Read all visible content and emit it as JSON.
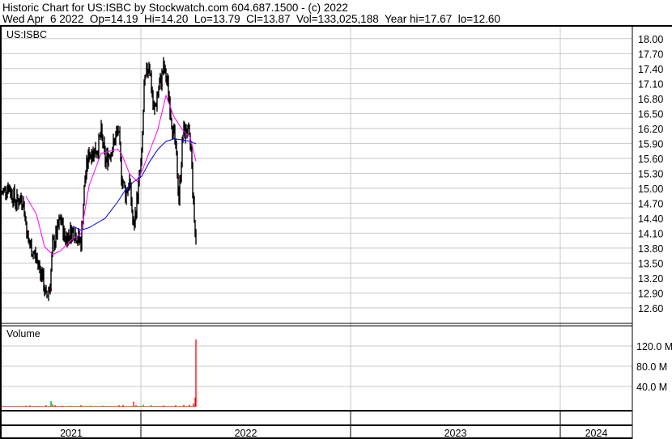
{
  "header": {
    "title": "Historic Chart for US:ISBC by Stockwatch.com 604.687.1500 - (c) 2022",
    "quote": "Wed Apr  6 2022  Op=14.19  Hi=14.20  Lo=13.79  Cl=13.87  Vol=133,025,188  Year hi=17.67  lo=12.60"
  },
  "chart_data": {
    "type": "line",
    "symbol": "US:ISBC",
    "x_unit": "trading days from chart start",
    "xlim": [
      0,
      779
    ],
    "year_boundaries": [
      172,
      431,
      690
    ],
    "year_labels": [
      "2021",
      "2022",
      "2023",
      "2024"
    ],
    "price": {
      "ylim": [
        12.29,
        18.24
      ],
      "ticks": [
        "18.00",
        "17.70",
        "17.40",
        "17.10",
        "16.80",
        "16.50",
        "16.20",
        "15.90",
        "15.60",
        "15.30",
        "15.00",
        "14.70",
        "14.40",
        "14.10",
        "13.80",
        "13.50",
        "13.20",
        "12.90",
        "12.60"
      ],
      "close": [
        [
          0,
          14.89
        ],
        [
          8,
          15.05
        ],
        [
          18,
          14.72
        ],
        [
          26,
          14.81
        ],
        [
          33,
          13.91
        ],
        [
          43,
          13.59
        ],
        [
          50,
          13.26
        ],
        [
          55,
          12.78
        ],
        [
          60,
          13.1
        ],
        [
          63,
          13.83
        ],
        [
          68,
          14.08
        ],
        [
          73,
          14.4
        ],
        [
          78,
          13.99
        ],
        [
          88,
          14.16
        ],
        [
          98,
          13.91
        ],
        [
          103,
          15.21
        ],
        [
          108,
          15.7
        ],
        [
          118,
          15.78
        ],
        [
          123,
          16.1
        ],
        [
          128,
          15.54
        ],
        [
          138,
          15.86
        ],
        [
          144,
          16.18
        ],
        [
          148,
          15.29
        ],
        [
          153,
          14.89
        ],
        [
          158,
          15.13
        ],
        [
          163,
          14.16
        ],
        [
          168,
          14.89
        ],
        [
          173,
          15.62
        ],
        [
          176,
          16.99
        ],
        [
          182,
          17.56
        ],
        [
          188,
          16.51
        ],
        [
          194,
          16.99
        ],
        [
          200,
          17.4
        ],
        [
          205,
          17.08
        ],
        [
          210,
          16.35
        ],
        [
          215,
          15.78
        ],
        [
          219,
          14.81
        ],
        [
          224,
          16.1
        ],
        [
          229,
          16.18
        ],
        [
          234,
          15.78
        ],
        [
          237,
          14.64
        ],
        [
          240,
          13.87
        ]
      ],
      "ma_short": [
        [
          30,
          14.84
        ],
        [
          43,
          14.48
        ],
        [
          53,
          13.83
        ],
        [
          63,
          13.67
        ],
        [
          73,
          13.75
        ],
        [
          88,
          13.99
        ],
        [
          98,
          14.08
        ],
        [
          108,
          15.05
        ],
        [
          123,
          15.7
        ],
        [
          143,
          15.78
        ],
        [
          148,
          15.7
        ],
        [
          158,
          15.29
        ],
        [
          168,
          15.13
        ],
        [
          178,
          15.54
        ],
        [
          193,
          16.18
        ],
        [
          203,
          16.86
        ],
        [
          213,
          16.43
        ],
        [
          223,
          16.18
        ],
        [
          233,
          16.02
        ],
        [
          240,
          15.54
        ]
      ],
      "ma_long": [
        [
          88,
          14.24
        ],
        [
          98,
          14.16
        ],
        [
          108,
          14.21
        ],
        [
          128,
          14.4
        ],
        [
          143,
          14.72
        ],
        [
          153,
          14.97
        ],
        [
          163,
          15.13
        ],
        [
          173,
          15.24
        ],
        [
          183,
          15.54
        ],
        [
          193,
          15.78
        ],
        [
          203,
          15.94
        ],
        [
          213,
          15.99
        ],
        [
          223,
          15.97
        ],
        [
          233,
          15.94
        ],
        [
          240,
          15.89
        ]
      ]
    },
    "volume": {
      "label": "Volume",
      "ylim": [
        0,
        160
      ],
      "unit": "M",
      "ticks": [
        "120.0 M",
        "80.0 M",
        "40.0 M"
      ],
      "tick_values": [
        120,
        80,
        40
      ],
      "baseline_million": 1.2,
      "bars": [
        [
          30,
          2,
          "red"
        ],
        [
          35,
          2.5,
          "red"
        ],
        [
          45,
          1.8,
          "green"
        ],
        [
          55,
          3,
          "red"
        ],
        [
          61,
          11,
          "green"
        ],
        [
          63,
          5,
          "green"
        ],
        [
          66,
          3,
          "red"
        ],
        [
          75,
          2,
          "red"
        ],
        [
          85,
          2,
          "green"
        ],
        [
          98,
          3,
          "red"
        ],
        [
          110,
          2,
          "green"
        ],
        [
          125,
          2.2,
          "green"
        ],
        [
          145,
          3,
          "red"
        ],
        [
          150,
          3.5,
          "red"
        ],
        [
          163,
          10,
          "red"
        ],
        [
          166,
          3,
          "red"
        ],
        [
          175,
          4,
          "green"
        ],
        [
          185,
          3,
          "green"
        ],
        [
          200,
          2.5,
          "red"
        ],
        [
          215,
          3,
          "red"
        ],
        [
          225,
          3.5,
          "red"
        ],
        [
          232,
          4,
          "red"
        ],
        [
          237,
          6,
          "red"
        ],
        [
          239,
          18,
          "red"
        ],
        [
          240,
          133,
          "red"
        ]
      ]
    },
    "colors": {
      "bars": "#000000",
      "close_tick": "#ff0000",
      "ma_short": "#ff00ff",
      "ma_long": "#0000ff",
      "grid": "#c8c8c8",
      "vol_up": "#00a000",
      "vol_down": "#ff0000"
    },
    "grid": true
  }
}
